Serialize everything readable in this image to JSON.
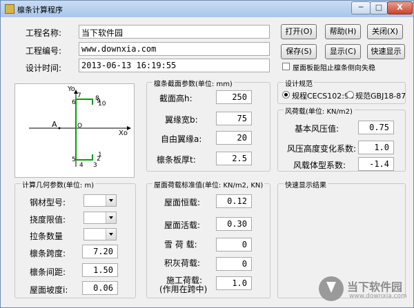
{
  "window": {
    "title": "檩条计算程序",
    "minimize": "─",
    "maximize": "□",
    "close": "X"
  },
  "project": {
    "name_label": "工程名称:",
    "name_value": "当下软件园",
    "number_label": "工程编号:",
    "number_value": "www.downxia.com",
    "time_label": "设计时间:",
    "time_value": "2013-06-13 16:19:55"
  },
  "buttons": {
    "open": "打开(O)",
    "help": "帮助(H)",
    "close": "关闭(X)",
    "save": "保存(S)",
    "display": "显示(C)",
    "quick_display": "快速显示"
  },
  "roof_check": {
    "label": "屋面板能阻止檩条侧向失稳"
  },
  "diagram": {
    "y_label": "Yo",
    "x_label": "Xo",
    "a_label": "A",
    "origin_label": "O",
    "points": [
      "6",
      "7",
      "8",
      "9",
      "10",
      "5",
      "4",
      "3",
      "2",
      "1"
    ]
  },
  "section": {
    "title": "檩条截面参数(单位: mm)",
    "fields": [
      {
        "label": "截面高h:",
        "value": "250"
      },
      {
        "label": "翼缘宽b:",
        "value": "75"
      },
      {
        "label": "自由翼缘a:",
        "value": "20"
      },
      {
        "label": "檩条板厚t:",
        "value": "2.5"
      }
    ]
  },
  "design_code": {
    "title": "设计规范",
    "option1": "规程CECS102:98",
    "option2": "规范GBJ18-87",
    "selected": "option1"
  },
  "wind": {
    "title": "风荷载(单位: KN/m2)",
    "fields": [
      {
        "label": "基本风压值:",
        "value": "0.75"
      },
      {
        "label": "风压高度变化系数:",
        "value": "1.0"
      },
      {
        "label": "风载体型系数:",
        "value": "-1.4"
      }
    ]
  },
  "geometry": {
    "title": "计算几何参数(单位: m)",
    "combos": [
      {
        "label": "钢材型号:",
        "value": ""
      },
      {
        "label": "挠度限值:",
        "value": ""
      },
      {
        "label": "拉条数量",
        "value": ""
      }
    ],
    "fields": [
      {
        "label": "檩条跨度:",
        "value": "7.20"
      },
      {
        "label": "檩条间距:",
        "value": "1.50"
      },
      {
        "label": "屋面坡度i:",
        "value": "0.06"
      }
    ]
  },
  "loads": {
    "title": "屋面荷载标准值(单位: KN/m2, KN)",
    "fields": [
      {
        "label": "屋面恒载:",
        "value": "0.12"
      },
      {
        "label": "屋面活载:",
        "value": "0.30"
      },
      {
        "label": "雪 荷 载:",
        "value": "0"
      },
      {
        "label": "积灰荷载:",
        "value": "0"
      }
    ],
    "construction_label_1": "施工荷载:",
    "construction_label_2": "(作用在跨中)",
    "construction_value": "1.0"
  },
  "quick_result": {
    "title": "快速显示结果"
  },
  "watermark": {
    "text": "当下软件园",
    "url": "www.downxia.com"
  }
}
